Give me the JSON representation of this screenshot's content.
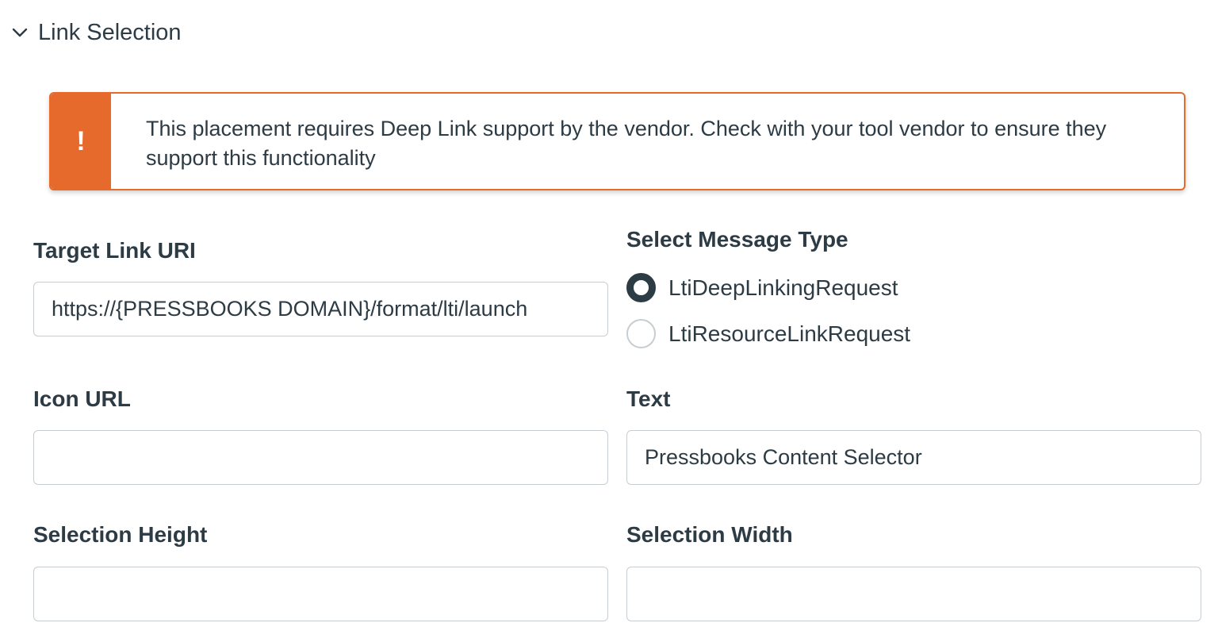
{
  "section": {
    "title": "Link Selection",
    "toggle_icon": "chevron-down-icon"
  },
  "alert": {
    "icon": "!",
    "icon_name": "warning-icon",
    "accent_color": "#e66a2c",
    "message": "This placement requires Deep Link support by the vendor. Check with your tool vendor to ensure they support this functionality"
  },
  "fields": {
    "target_link_uri": {
      "label": "Target Link URI",
      "value": "https://{PRESSBOOKS DOMAIN}/format/lti/launch"
    },
    "message_type": {
      "label": "Select Message Type",
      "options": [
        {
          "label": "LtiDeepLinkingRequest",
          "checked": true
        },
        {
          "label": "LtiResourceLinkRequest",
          "checked": false
        }
      ]
    },
    "icon_url": {
      "label": "Icon URL",
      "value": ""
    },
    "text": {
      "label": "Text",
      "value": "Pressbooks Content Selector"
    },
    "selection_height": {
      "label": "Selection Height",
      "value": ""
    },
    "selection_width": {
      "label": "Selection Width",
      "value": ""
    }
  }
}
